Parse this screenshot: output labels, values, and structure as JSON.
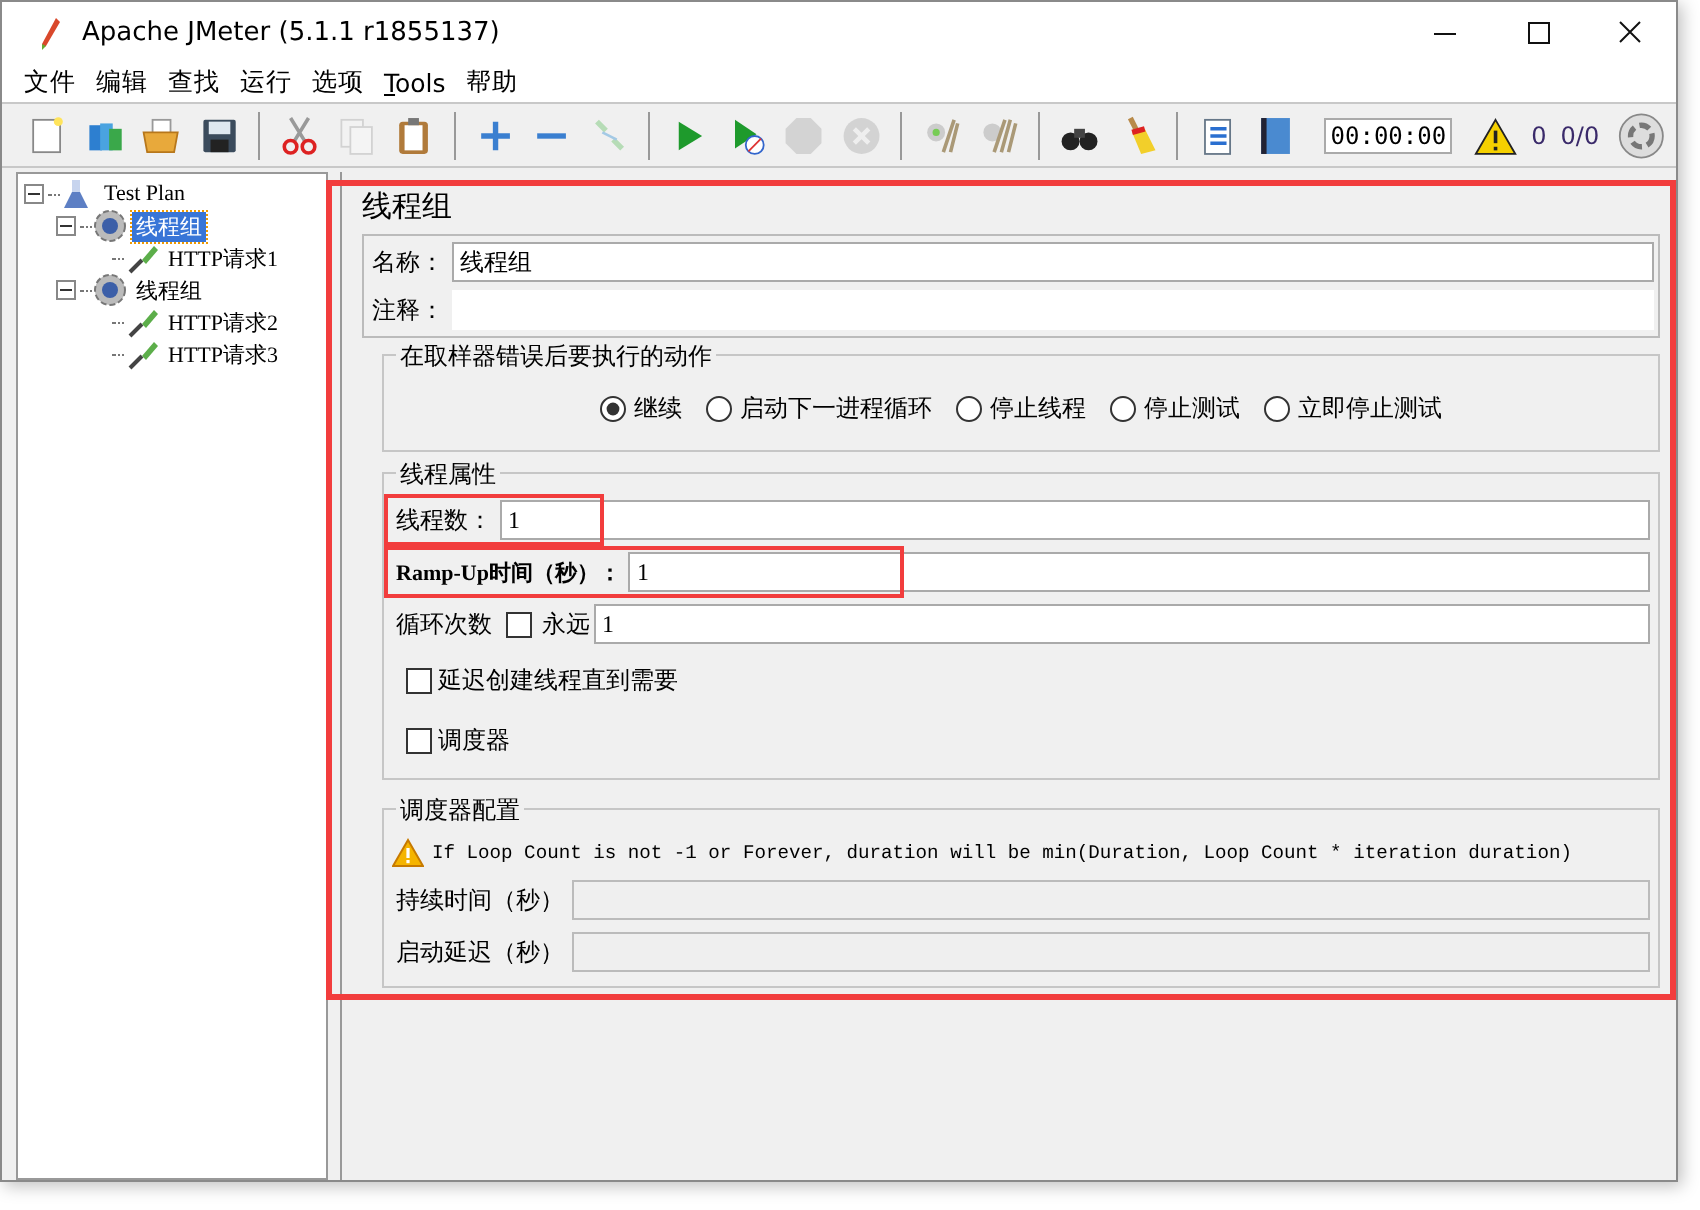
{
  "window": {
    "title": "Apache JMeter (5.1.1 r1855137)"
  },
  "menu": [
    {
      "label": "文件",
      "underlined": false
    },
    {
      "label": "编辑",
      "underlined": false
    },
    {
      "label": "查找",
      "underlined": false
    },
    {
      "label": "运行",
      "underlined": false
    },
    {
      "label": "选项",
      "underlined": false
    },
    {
      "label": "Tools",
      "underlined": true
    },
    {
      "label": "帮助",
      "underlined": false
    }
  ],
  "toolbar": [
    [
      {
        "kind": "new",
        "disabled": false
      },
      {
        "kind": "templates",
        "disabled": false
      },
      {
        "kind": "open",
        "disabled": false
      },
      {
        "kind": "save",
        "disabled": false
      }
    ],
    [
      {
        "kind": "cut",
        "disabled": false
      },
      {
        "kind": "copy",
        "disabled": true
      },
      {
        "kind": "paste",
        "disabled": false
      }
    ],
    [
      {
        "kind": "add",
        "disabled": false
      },
      {
        "kind": "remove",
        "disabled": false
      },
      {
        "kind": "toggle",
        "disabled": true
      }
    ],
    [
      {
        "kind": "start",
        "disabled": false
      },
      {
        "kind": "start-no-pause",
        "disabled": false
      },
      {
        "kind": "stop",
        "disabled": true
      },
      {
        "kind": "shutdown",
        "disabled": true
      }
    ],
    [
      {
        "kind": "clear",
        "disabled": false
      },
      {
        "kind": "clear-all",
        "disabled": false
      }
    ],
    [
      {
        "kind": "search",
        "disabled": false
      },
      {
        "kind": "reset",
        "disabled": false
      }
    ],
    [
      {
        "kind": "functions",
        "disabled": false
      },
      {
        "kind": "help",
        "disabled": false
      }
    ]
  ],
  "status": {
    "timer": "00:00:00",
    "warnings": "0",
    "threads": "0/0"
  },
  "tree": [
    {
      "label": "Test Plan",
      "kind": "plan",
      "selected": false,
      "expanded": true,
      "children": [
        {
          "label": "线程组",
          "kind": "thread-group",
          "selected": true,
          "expanded": true,
          "children": [
            {
              "label": "HTTP请求1",
              "kind": "sampler",
              "selected": false
            }
          ]
        },
        {
          "label": "线程组",
          "kind": "thread-group",
          "selected": false,
          "expanded": true,
          "children": [
            {
              "label": "HTTP请求2",
              "kind": "sampler",
              "selected": false
            },
            {
              "label": "HTTP请求3",
              "kind": "sampler",
              "selected": false
            }
          ]
        }
      ]
    }
  ],
  "panel": {
    "title": "线程组",
    "name": {
      "label": "名称：",
      "value": "线程组"
    },
    "comment": {
      "label": "注释："
    },
    "error_action": {
      "legend": "在取样器错误后要执行的动作",
      "options": [
        {
          "label": "继续",
          "selected": true
        },
        {
          "label": "启动下一进程循环",
          "selected": false
        },
        {
          "label": "停止线程",
          "selected": false
        },
        {
          "label": "停止测试",
          "selected": false
        },
        {
          "label": "立即停止测试",
          "selected": false
        }
      ]
    },
    "thread_properties": {
      "legend": "线程属性",
      "threads": {
        "label": "线程数：",
        "value": "1",
        "highlighted": true
      },
      "ramp_up": {
        "label": "Ramp-Up时间（秒）：",
        "value": "1",
        "highlighted": true
      },
      "loop": {
        "label": "循环次数",
        "forever_label": "永远",
        "forever_checked": false,
        "value": "1"
      },
      "checkboxes": [
        {
          "label": "延迟创建线程直到需要",
          "checked": false
        },
        {
          "label": "调度器",
          "checked": false
        }
      ]
    },
    "scheduler": {
      "legend": "调度器配置",
      "warning": "If Loop Count is not -1 or Forever, duration will be min(Duration, Loop Count * iteration duration)",
      "fields": [
        {
          "label": "持续时间（秒）",
          "disabled": true
        },
        {
          "label": "启动延迟（秒）",
          "disabled": true
        }
      ]
    },
    "highlighted": true
  }
}
